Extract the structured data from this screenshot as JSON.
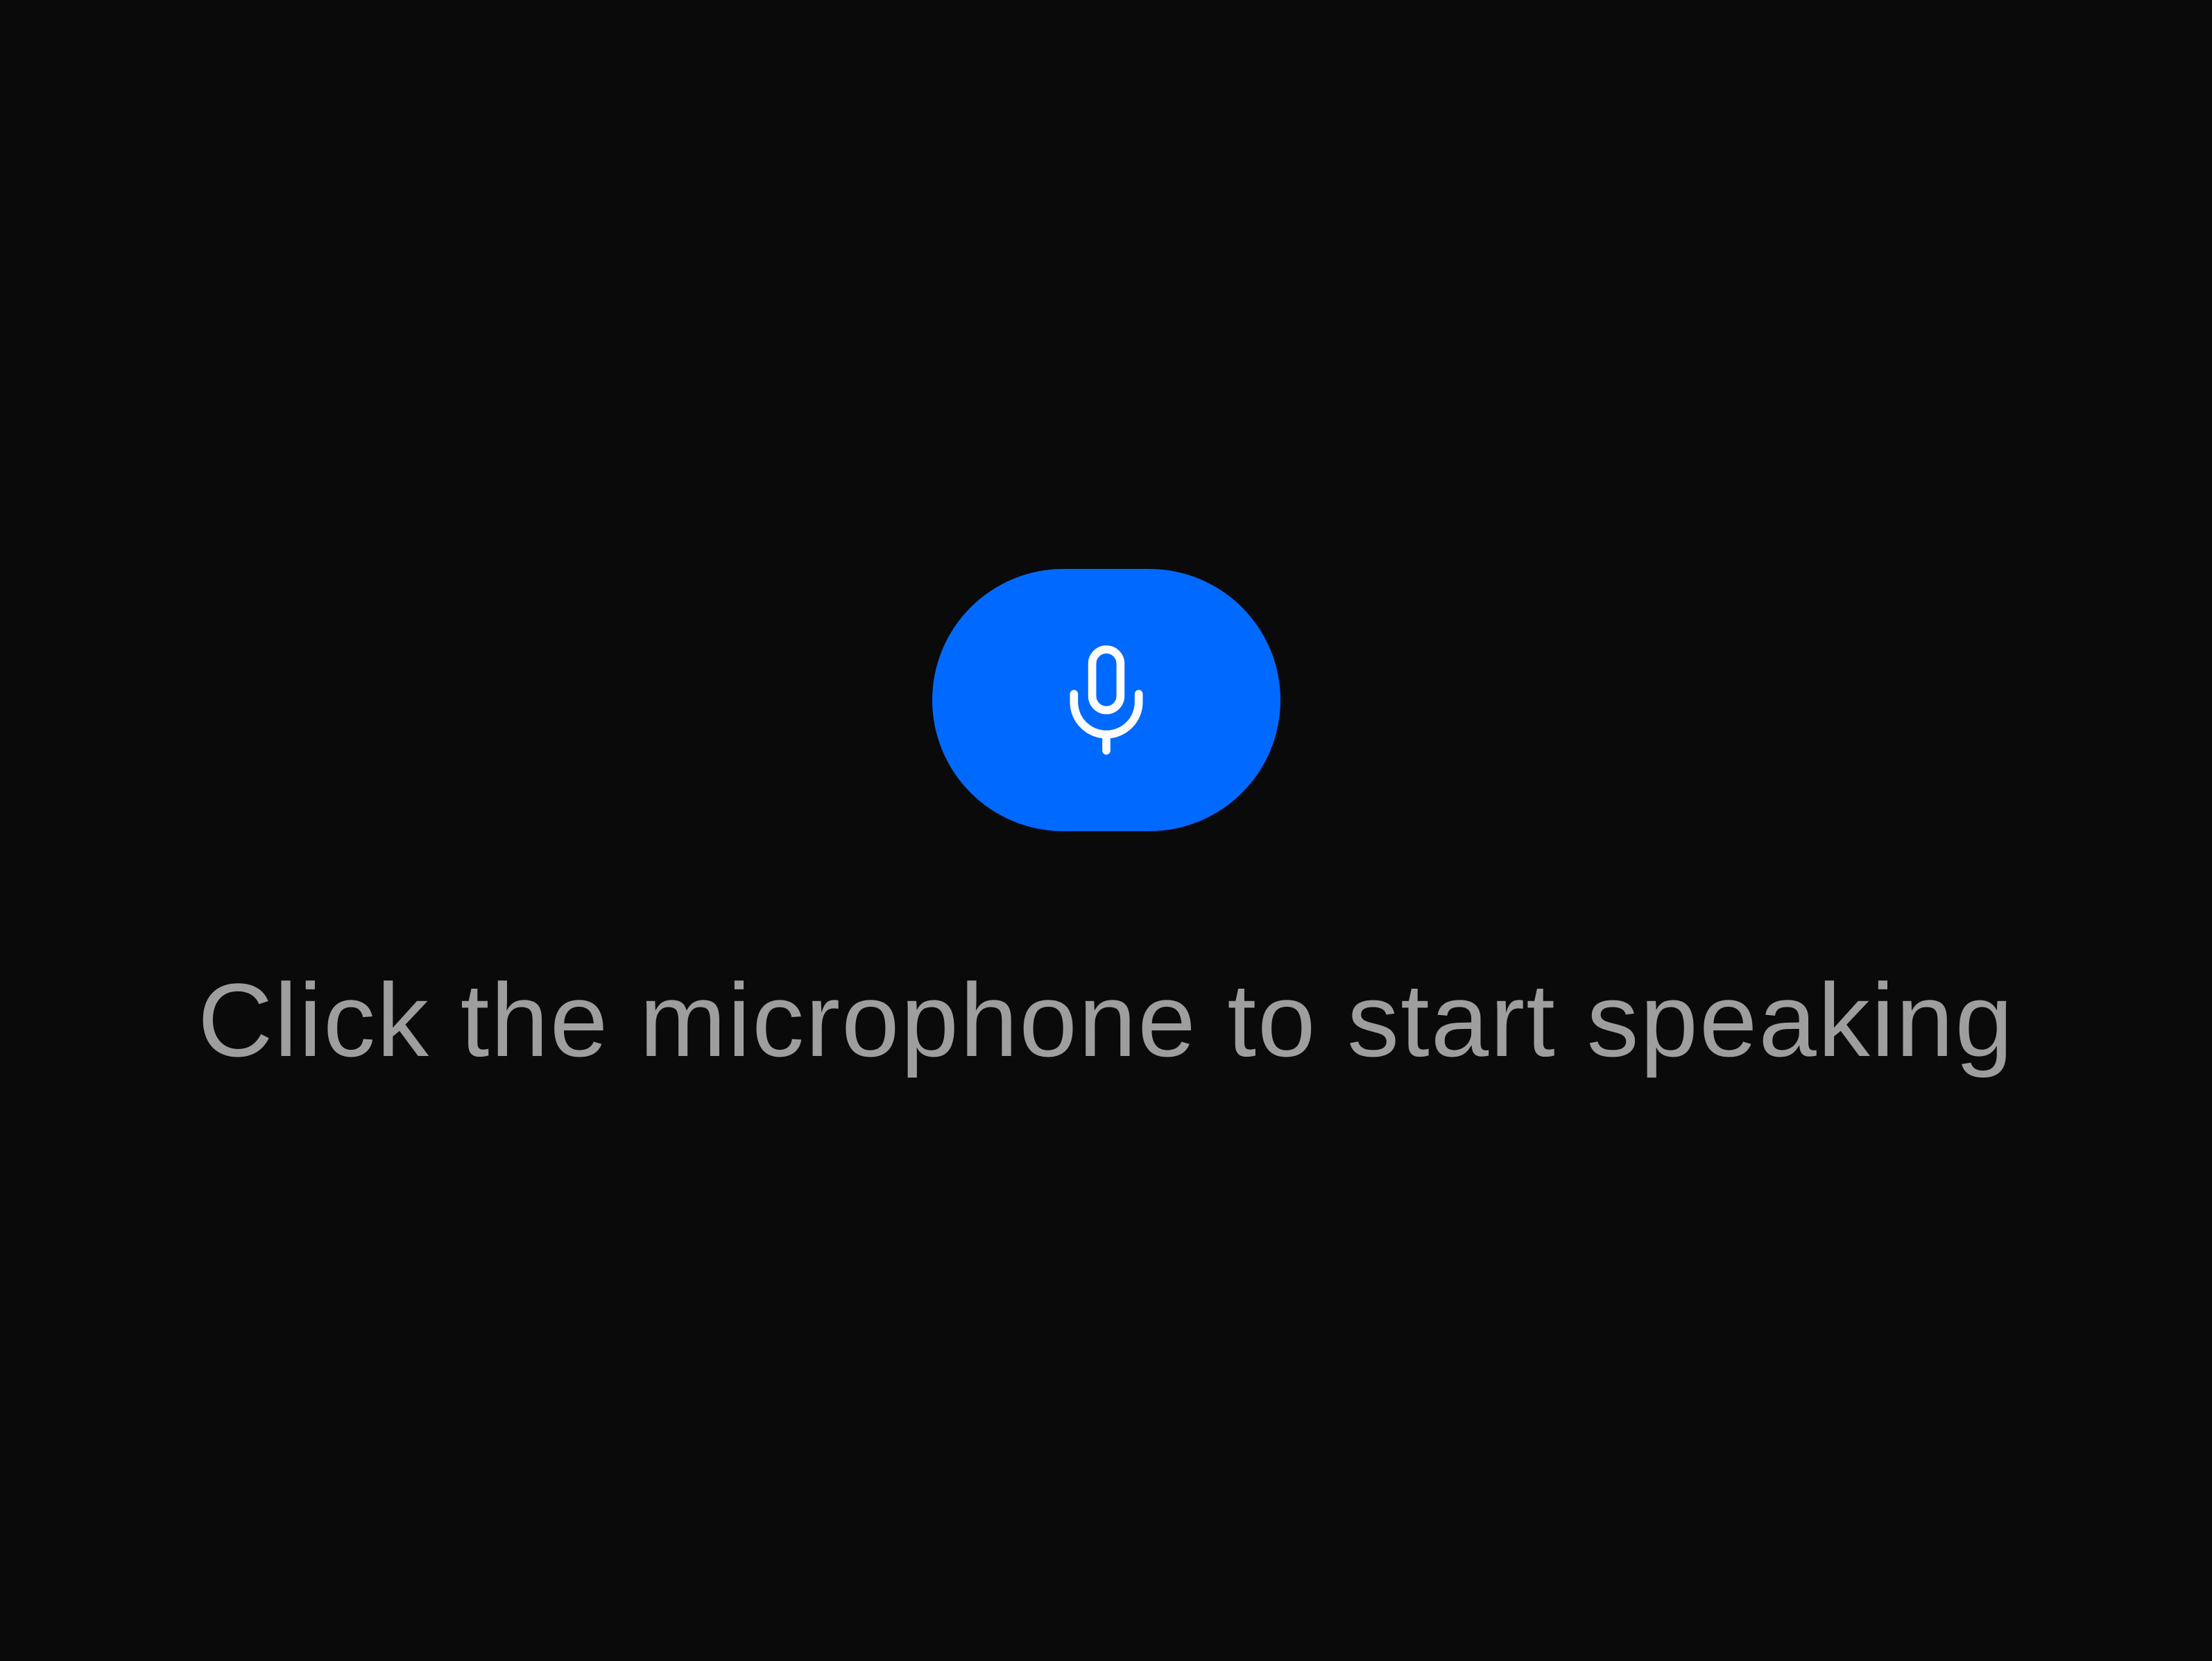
{
  "microphone_button": {
    "icon": "microphone-icon",
    "color": "#0069ff"
  },
  "prompt": {
    "text": "Click the microphone to start speaking",
    "color": "#9e9e9e"
  },
  "background_color": "#0a0a0b"
}
